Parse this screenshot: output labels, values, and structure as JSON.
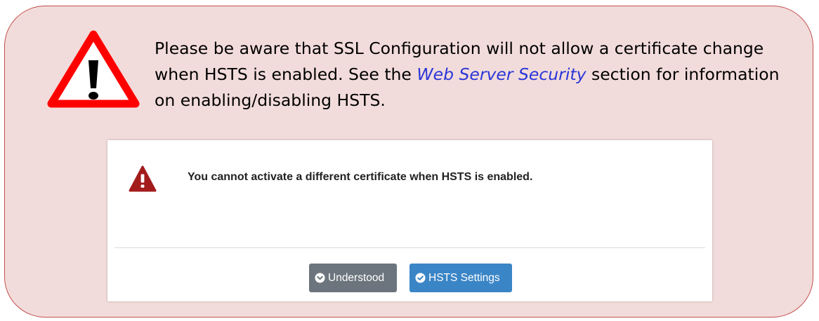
{
  "notice": {
    "icon": "warning-triangle-icon",
    "text_before_link": "Please be aware that SSL Configuration will not allow a certificate change when HSTS is enabled. See the ",
    "link_text": "Web Server Security",
    "text_after_link": " section for information on enabling/disabling HSTS."
  },
  "dialog": {
    "icon": "warning-triangle-icon",
    "message": "You cannot activate a different certificate when HSTS is enabled.",
    "buttons": [
      {
        "label": "Understood",
        "icon": "circle-chevron-down-icon"
      },
      {
        "label": "HSTS Settings",
        "icon": "circle-check-icon"
      }
    ]
  },
  "colors": {
    "callout_background": "#f2dcdb",
    "callout_border": "#c0504d",
    "warning_red": "#ff0000",
    "link": "#2a35d8",
    "dialog_icon_red": "#a31c1c",
    "button_secondary": "#6c757d",
    "button_primary": "#3a85c6"
  }
}
